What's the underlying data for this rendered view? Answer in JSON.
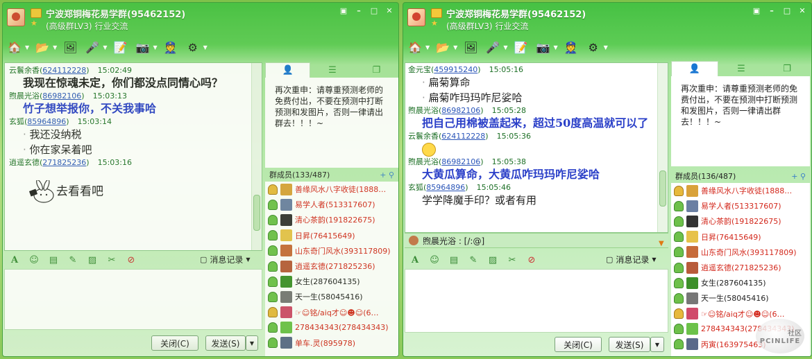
{
  "left": {
    "title": "宁波郑铜梅花易学群(95462152)",
    "subtitle": "(高级群LV3) 行业交流",
    "messages": [
      {
        "name": "云鬟余香",
        "uid": "624112228",
        "time": "15:02:49",
        "lines": [
          "我现在惊魂未定，你们都没点同情心吗？"
        ],
        "style": "bold-line"
      },
      {
        "name": "煦晨光浴",
        "uid": "86982106",
        "time": "15:03:13",
        "lines": [
          "竹子想举报你，不关我事哈"
        ],
        "style": "bold"
      },
      {
        "name": "玄狐",
        "uid": "85964896",
        "time": "15:03:14",
        "lines": [
          "我还没纳税",
          "你在家呆着吧"
        ],
        "style": "dot"
      },
      {
        "name": "逍遥玄德",
        "uid": "271825236",
        "time": "15:03:16",
        "lines": [
          "去看看吧"
        ],
        "style": "sticker"
      }
    ],
    "history_label": "消息记录",
    "close_label": "关闭(C)",
    "send_label": "发送(S)",
    "notice": "再次重申：请尊重预测老师的免费付出，不要在预测中打断预测和发图片，否则一律请出群去！！！~",
    "members_label": "群成员(133/487)",
    "members": [
      {
        "name": "善缘风水八字收徒(1888…",
        "color": "red"
      },
      {
        "name": "易学人者(513317607)",
        "color": "red"
      },
      {
        "name": "清心茶韵(191822675)",
        "color": "red"
      },
      {
        "name": "日昇(76415649)",
        "color": "red"
      },
      {
        "name": "山东奇门风水(393117809)",
        "color": "red"
      },
      {
        "name": "逍遥玄德(271825236)",
        "color": "red"
      },
      {
        "name": "女生(287604135)",
        "color": "dark"
      },
      {
        "name": "天一生(58045416)",
        "color": "dark"
      },
      {
        "name": "☞☺铭/aiq才☺☻☺(6…",
        "color": "red"
      },
      {
        "name": "278434343(278434343)",
        "color": "red"
      },
      {
        "name": "单车.灵(895978)",
        "color": "red"
      }
    ]
  },
  "right": {
    "title": "宁波郑铜梅花易学群(95462152)",
    "subtitle": "(高级群LV3) 行业交流",
    "messages": [
      {
        "name": "金元宝",
        "uid": "459915240",
        "time": "15:05:16",
        "lines": [
          "扁菊算命",
          "扁菊咋玛玛咋尼娑哈"
        ],
        "style": "dot"
      },
      {
        "name": "煦晨光浴",
        "uid": "86982106",
        "time": "15:05:28",
        "lines": [
          "把自己用棉被盖起来，超过50度高温就可以了"
        ],
        "style": "bold"
      },
      {
        "name": "云鬟余香",
        "uid": "624112228",
        "time": "15:05:36",
        "lines": [
          ""
        ],
        "style": "emoji"
      },
      {
        "name": "煦晨光浴",
        "uid": "86982106",
        "time": "15:05:38",
        "lines": [
          "大黄瓜算命，大黄瓜咋玛玛咋尼娑哈"
        ],
        "style": "bold"
      },
      {
        "name": "玄狐",
        "uid": "85964896",
        "time": "15:05:46",
        "lines": [
          "学学降魔手印？或者有用"
        ],
        "style": "plain"
      }
    ],
    "reply_text": "煦晨光浴 : [/:@]",
    "history_label": "消息记录",
    "close_label": "关闭(C)",
    "send_label": "发送(S)",
    "notice": "再次重申：请尊重预测老师的免费付出，不要在预测中打断预测和发图片，否则一律请出群去！！！~",
    "members_label": "群成员(136/487)",
    "members": [
      {
        "name": "善缘风水八字收徒(1888…",
        "color": "red"
      },
      {
        "name": "易学人者(513317607)",
        "color": "red"
      },
      {
        "name": "清心茶韵(191822675)",
        "color": "red"
      },
      {
        "name": "日昇(76415649)",
        "color": "red"
      },
      {
        "name": "山东奇门风水(393117809)",
        "color": "red"
      },
      {
        "name": "逍遥玄德(271825236)",
        "color": "red"
      },
      {
        "name": "女生(287604135)",
        "color": "dark"
      },
      {
        "name": "天一生(58045416)",
        "color": "dark"
      },
      {
        "name": "☞☺铭/aiq才☺☻☺(6…",
        "color": "red"
      },
      {
        "name": "278434343(278434343)",
        "color": "red"
      },
      {
        "name": "丙寅(163975463)",
        "color": "red"
      }
    ],
    "watermark_top": "社区",
    "watermark_text": "PCINLIFE"
  },
  "colors": {
    "accent": "#46c143",
    "name_red": "#d3281c",
    "bold_blue": "#2a3fc8"
  }
}
